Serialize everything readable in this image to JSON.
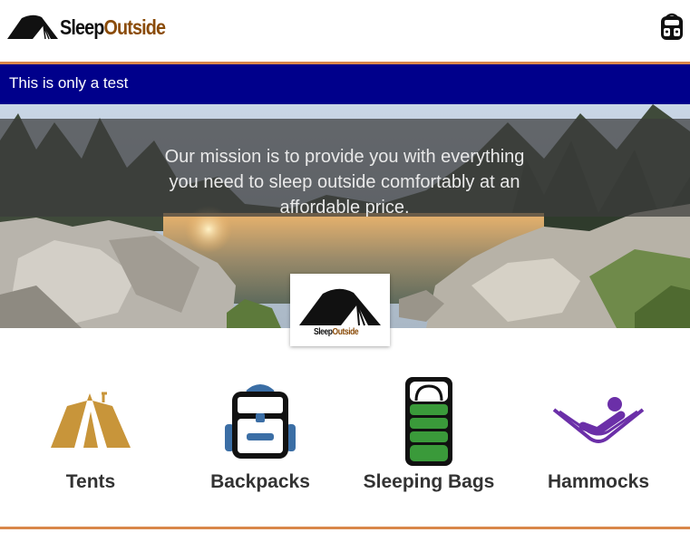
{
  "header": {
    "logo_sleep": "Sleep",
    "logo_outside": "Outside",
    "cart_icon": "backpack-cart-icon"
  },
  "alert": {
    "message": "This is only a test",
    "background": "#00008b"
  },
  "hero": {
    "mission": "Our mission is to provide you with everything you need to sleep outside comfortably at an affordable price.",
    "logo_sleep": "Sleep",
    "logo_outside": "Outside"
  },
  "categories": [
    {
      "label": "Tents",
      "icon": "tent-icon",
      "color": "#c8953a"
    },
    {
      "label": "Backpacks",
      "icon": "backpack-icon",
      "color": "#3b6ea5"
    },
    {
      "label": "Sleeping Bags",
      "icon": "sleeping-bag-icon",
      "color": "#3a9a3a"
    },
    {
      "label": "Hammocks",
      "icon": "hammock-icon",
      "color": "#6b2fa8"
    }
  ],
  "colors": {
    "accent": "#d9874a",
    "brand_brown": "#8a4b08"
  }
}
